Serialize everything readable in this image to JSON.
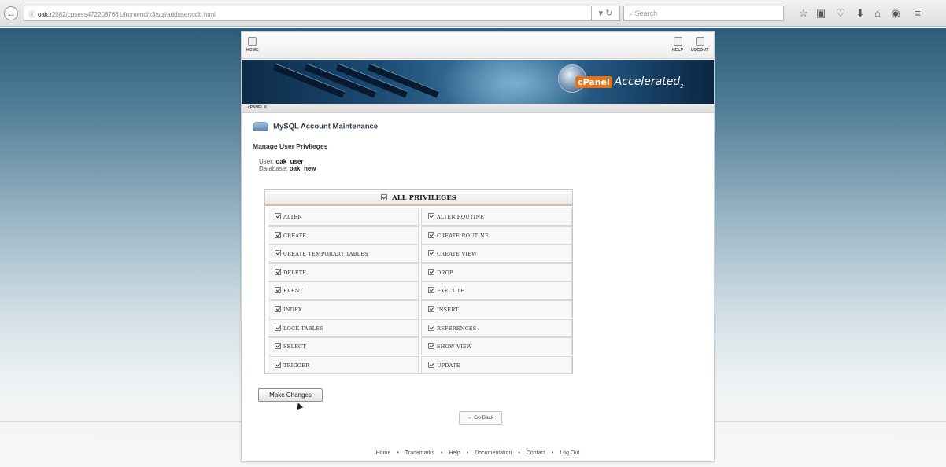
{
  "browser": {
    "url_host": "oak.r",
    "url_path": "2082/cpsess4722087661/frontend/x3/sql/addusertodb.html",
    "search_placeholder": "Search",
    "icons": [
      "star-icon",
      "clipboard-icon",
      "pocket-icon",
      "download-icon",
      "home-icon",
      "shield-icon",
      "menu-icon"
    ]
  },
  "topnav": {
    "left": "HOME",
    "right": [
      "HELP",
      "LOGOUT"
    ]
  },
  "banner": {
    "brand": "cPanel",
    "tagline": "Accelerated",
    "superscript": "2"
  },
  "breadcrumb": "cPANEL X",
  "page": {
    "title": "MySQL Account Maintenance",
    "subtitle": "Manage User Privileges",
    "user_label": "User:",
    "user_value": "oak_user",
    "database_label": "Database:",
    "database_value": "oak_new"
  },
  "privileges": {
    "header": "ALL PRIVILEGES",
    "all_checked": true,
    "left": [
      "ALTER",
      "CREATE",
      "CREATE TEMPORARY TABLES",
      "DELETE",
      "EVENT",
      "INDEX",
      "LOCK TABLES",
      "SELECT",
      "TRIGGER"
    ],
    "right": [
      "ALTER ROUTINE",
      "CREATE ROUTINE",
      "CREATE VIEW",
      "DROP",
      "EXECUTE",
      "INSERT",
      "REFERENCES",
      "SHOW VIEW",
      "UPDATE"
    ]
  },
  "buttons": {
    "make_changes": "Make Changes",
    "go_back": "← Go Back"
  },
  "footer": [
    "Home",
    "Trademarks",
    "Help",
    "Documentation",
    "Contact",
    "Log Out"
  ]
}
